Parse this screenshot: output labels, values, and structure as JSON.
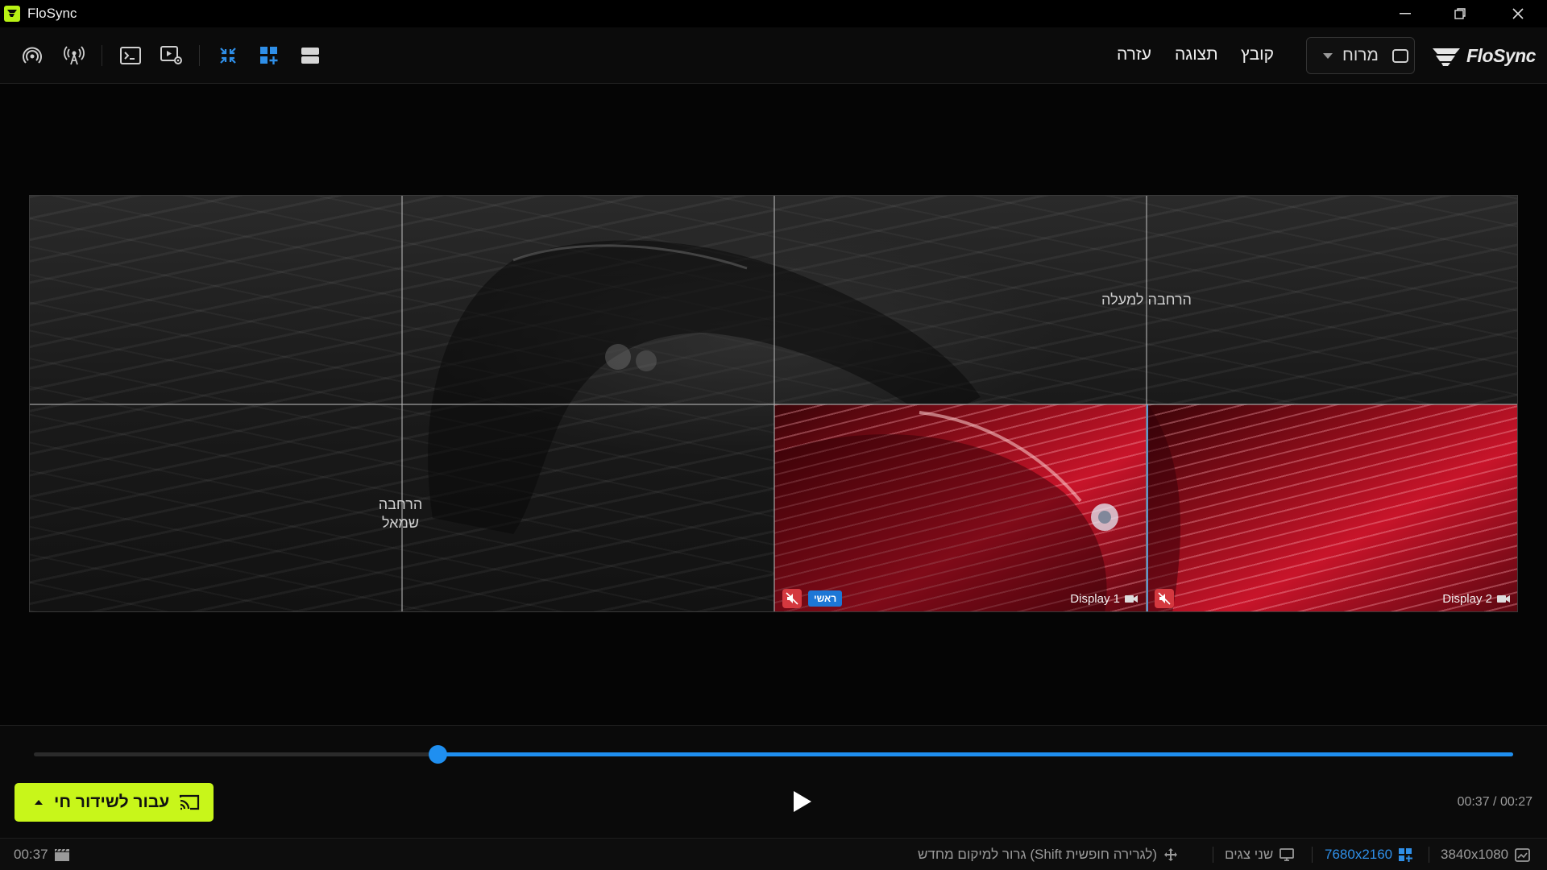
{
  "window": {
    "title": "FloSync"
  },
  "menu": {
    "file": "קובץ",
    "view": "תצוגה",
    "help": "עזרה"
  },
  "mode_select": {
    "value": "מרוח"
  },
  "brand": {
    "name": "FloSync"
  },
  "canvas": {
    "expand_up_label": "הרחבה למעלה",
    "expand_left_label_line1": "הרחבה",
    "expand_left_label_line2": "שמאל",
    "displays": [
      {
        "label": "Display 1",
        "primary_badge": "ראשי",
        "muted": true
      },
      {
        "label": "Display 2",
        "muted": true
      }
    ]
  },
  "timeline": {
    "progress": 0.273
  },
  "controls": {
    "live_button_label": "עבור לשידור חי",
    "time_current": "00:27",
    "time_total": "00:37",
    "time_separator": " / "
  },
  "status": {
    "duration": "00:37",
    "drag_hint": "גרור למיקום מחדש (Shift לגרירה חופשית)",
    "displays_count": "שני צגים",
    "canvas_resolution": "7680x2160",
    "display_resolution": "3840x1080"
  },
  "colors": {
    "accent": "#1f8ff0",
    "live": "#c8f61a",
    "mute": "#d4383f"
  }
}
